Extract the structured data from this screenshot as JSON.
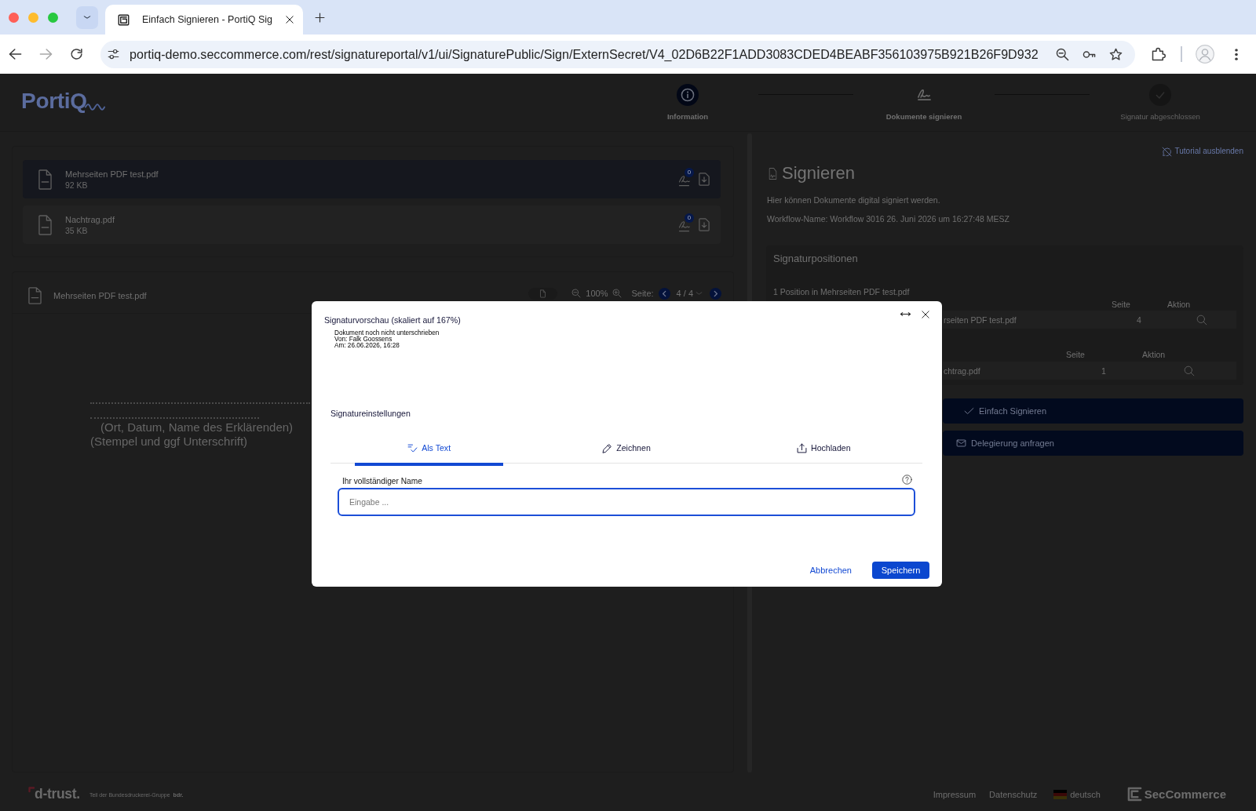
{
  "browser": {
    "tab_title": "Einfach Signieren - PortiQ Sig",
    "url": "portiq-demo.seccommerce.com/rest/signatureportal/v1/ui/SignaturePublic/Sign/ExternSecret/V4_02D6B22F1ADD3083CDED4BEABF356103975B921B26F9D932"
  },
  "header": {
    "logo": "PortiQ",
    "steps": [
      {
        "label": "Information",
        "kind": "info",
        "completed": true,
        "disabled": false
      },
      {
        "label": "Dokumente signieren",
        "kind": "sign",
        "completed": false,
        "disabled": false
      },
      {
        "label": "Signatur abgeschlossen",
        "kind": "check",
        "completed": false,
        "disabled": true
      }
    ]
  },
  "files": [
    {
      "name": "Mehrseiten PDF test.pdf",
      "size": "92 KB",
      "badge": "0",
      "selected": true
    },
    {
      "name": "Nachtrag.pdf",
      "size": "35 KB",
      "badge": "0",
      "selected": false
    }
  ],
  "viewer": {
    "file_name": "Mehrseiten PDF test.pdf",
    "zoom": "100%",
    "page_label": "Seite:",
    "page": "4 / 4",
    "document_lines": [
      "(Ort, Datum, Name des Erklärenden)",
      "(Stempel und ggf Unterschrift)"
    ]
  },
  "sign_panel": {
    "tutorial_link": "Tutorial ausblenden",
    "title": "Signieren",
    "description": "Hier können Dokumente digital signiert werden.",
    "workflow": "Workflow-Name: Workflow 3016 26. Juni 2026 um 16:27:48 MESZ",
    "positions": {
      "title": "Signaturpositionen",
      "groups": [
        {
          "heading": "1 Position in Mehrseiten PDF test.pdf",
          "columns": [
            "Seite",
            "Aktion"
          ],
          "rows": [
            {
              "document": "rseiten PDF test.pdf",
              "page": "4"
            }
          ]
        },
        {
          "columns": [
            "Seite",
            "Aktion"
          ],
          "rows": [
            {
              "document": "chtrag.pdf",
              "page": "1"
            }
          ]
        }
      ]
    },
    "actions": [
      {
        "label": "Einfach Signieren",
        "kind": "sign"
      },
      {
        "label": "Delegierung anfragen",
        "kind": "delegate"
      }
    ]
  },
  "dialog": {
    "title": "Signaturvorschau (skaliert auf 167%)",
    "preview_lines": [
      "Dokument noch nicht unterschrieben",
      "Von: Falk Goossens",
      "Am: 26.06.2026, 16:28"
    ],
    "settings_title": "Signatureinstellungen",
    "tabs": [
      {
        "label": "Als Text",
        "kind": "text",
        "selected": true
      },
      {
        "label": "Zeichnen",
        "kind": "draw",
        "selected": false
      },
      {
        "label": "Hochladen",
        "kind": "upload",
        "selected": false
      }
    ],
    "name_field": {
      "label": "Ihr vollständiger Name",
      "placeholder": "Eingabe ..."
    },
    "buttons": [
      {
        "label": "Abbrechen",
        "kind": "secondary"
      },
      {
        "label": "Speichern",
        "kind": "primary"
      }
    ]
  },
  "footer": {
    "logo": "d-trust.",
    "tagline": "Teil der Bundesdruckerei-Gruppe",
    "tagline_logo": "bdr.",
    "links": [
      "Impressum",
      "Datenschutz"
    ],
    "language": "deutsch",
    "brand": "SecCommerce"
  }
}
